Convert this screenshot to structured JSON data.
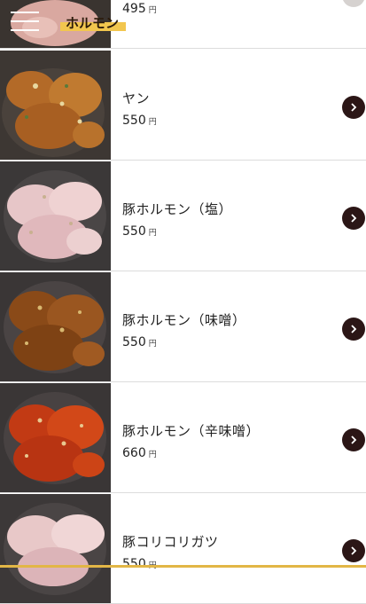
{
  "header": {
    "category": "ホルモン",
    "menu_icon": "hamburger-menu-icon"
  },
  "items": [
    {
      "name": "",
      "price": "495",
      "yen": "円"
    },
    {
      "name": "ヤン",
      "price": "550",
      "yen": "円"
    },
    {
      "name": "豚ホルモン（塩）",
      "price": "550",
      "yen": "円"
    },
    {
      "name": "豚ホルモン（味噌）",
      "price": "550",
      "yen": "円"
    },
    {
      "name": "豚ホルモン（辛味噌）",
      "price": "660",
      "yen": "円"
    },
    {
      "name": "豚コリコリガツ",
      "price": "550",
      "yen": "円"
    }
  ],
  "colors": {
    "accent": "#f2c64e",
    "arrow_bg": "#2b1616",
    "bottom_bar": "#e2b646"
  }
}
